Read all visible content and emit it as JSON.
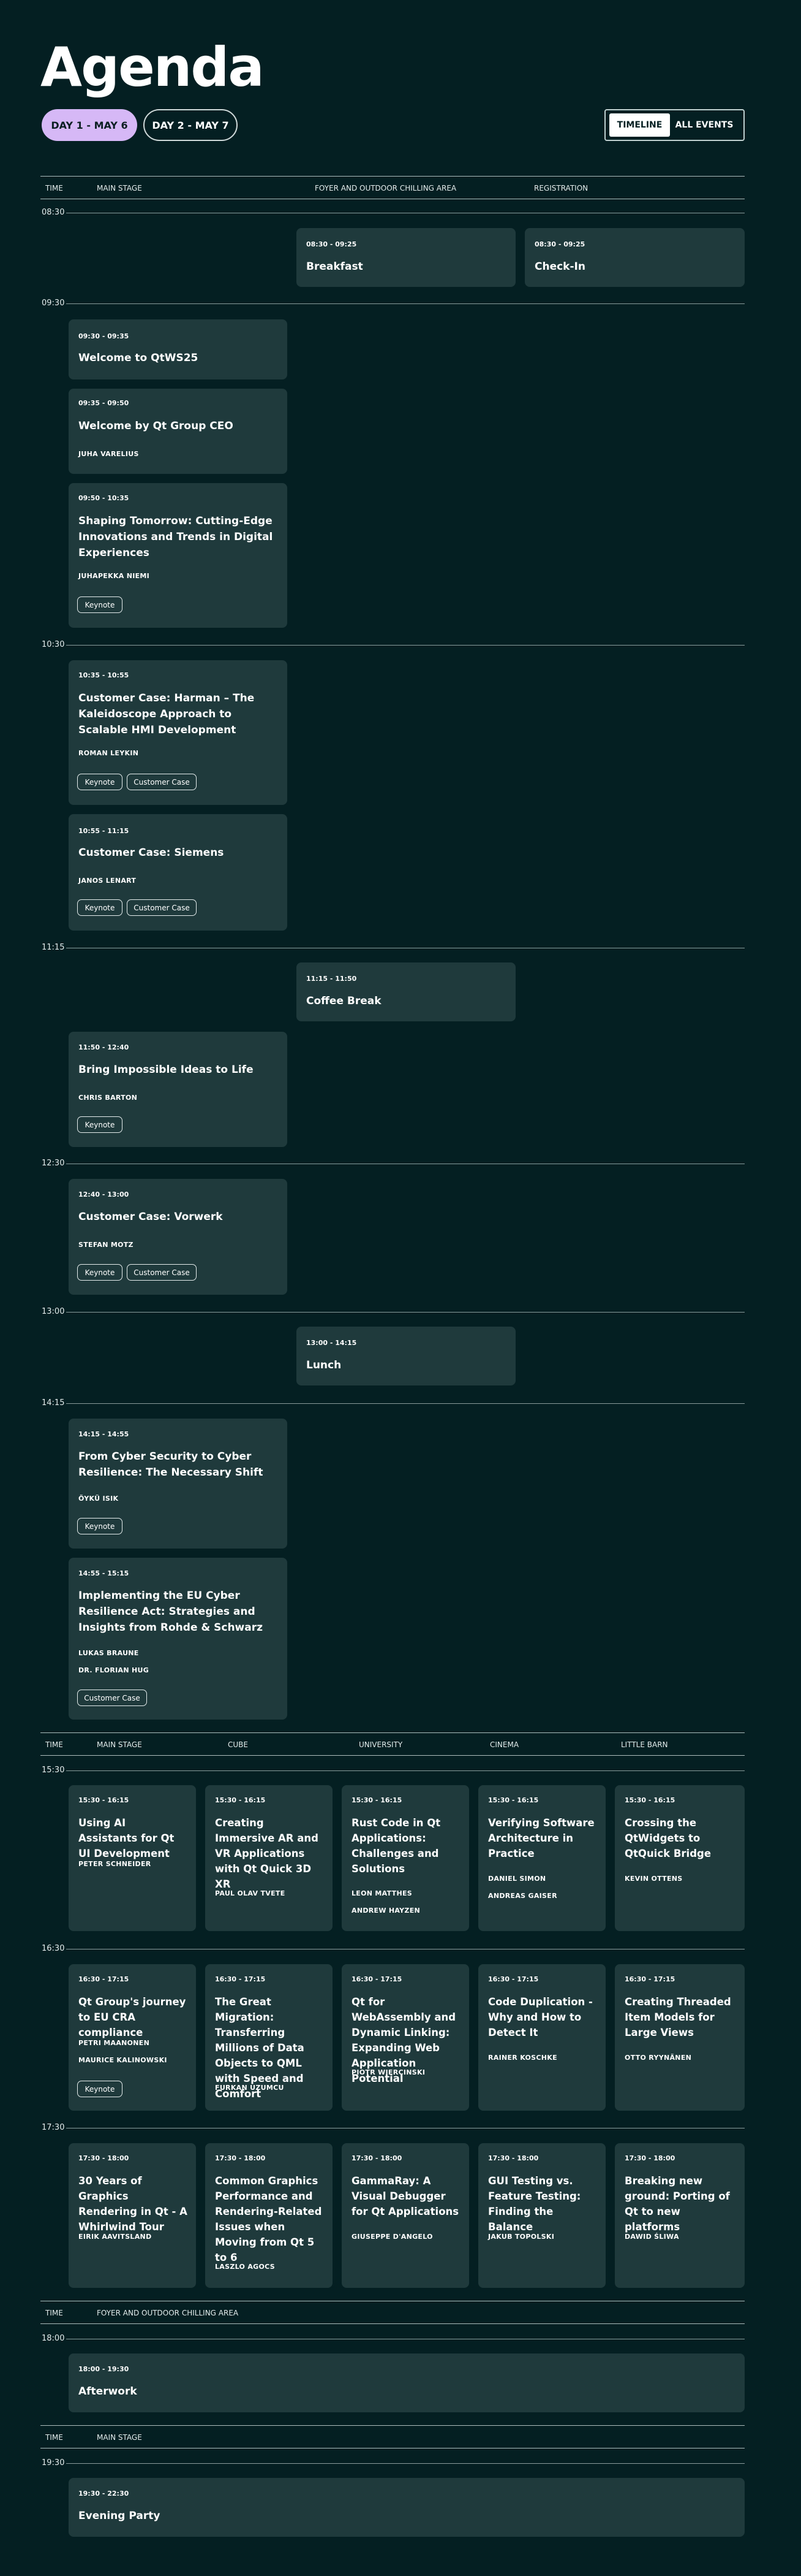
{
  "page": {
    "title": "Agenda"
  },
  "days": {
    "day1": "DAY 1 - MAY 6",
    "day2": "DAY 2 - MAY 7"
  },
  "view": {
    "timeline": "TIMELINE",
    "all_events": "ALL EVENTS"
  },
  "headers": {
    "time": "TIME",
    "main_stage": "MAIN STAGE",
    "foyer": "FOYER AND OUTDOOR CHILLING AREA",
    "registration": "REGISTRATION",
    "cube": "CUBE",
    "university": "UNIVERSITY",
    "cinema": "CINEMA",
    "little_barn": "LITTLE BARN"
  },
  "times": [
    "08:30",
    "09:30",
    "10:30",
    "11:15",
    "12:30",
    "13:00",
    "14:15",
    "15:30",
    "16:30",
    "17:30",
    "18:00",
    "19:30"
  ],
  "tags": {
    "keynote": "Keynote",
    "customer_case": "Customer Case"
  },
  "sessions": {
    "breakfast": {
      "time": "08:30 - 09:25",
      "title": "Breakfast"
    },
    "checkin": {
      "time": "08:30 - 09:25",
      "title": "Check-In"
    },
    "welcome": {
      "time": "09:30 - 09:35",
      "title": "Welcome to QtWS25"
    },
    "ceo": {
      "time": "09:35 - 09:50",
      "title": "Welcome by Qt Group CEO",
      "speaker": "JUHA VARELIUS"
    },
    "shaping": {
      "time": "09:50 - 10:35",
      "title": "Shaping Tomorrow: Cutting-Edge Innovations and Trends in Digital Experiences",
      "speaker": "JUHAPEKKA NIEMI"
    },
    "harman": {
      "time": "10:35 - 10:55",
      "title": "Customer Case: Harman – The Kaleidoscope Approach to Scalable HMI Development",
      "speaker": "ROMAN LEYKIN"
    },
    "siemens": {
      "time": "10:55 - 11:15",
      "title": "Customer Case: Siemens",
      "speaker": "JANOS LENART"
    },
    "coffee": {
      "time": "11:15 - 11:50",
      "title": "Coffee Break"
    },
    "bring": {
      "time": "11:50 - 12:40",
      "title": "Bring Impossible Ideas to Life",
      "speaker": "CHRIS BARTON"
    },
    "vorwerk": {
      "time": "12:40 - 13:00",
      "title": "Customer Case: Vorwerk",
      "speaker": "STEFAN MOTZ"
    },
    "lunch": {
      "time": "13:00 - 14:15",
      "title": "Lunch"
    },
    "cyber": {
      "time": "14:15 - 14:55",
      "title": "From Cyber Security to Cyber Resilience: The Necessary Shift",
      "speaker": "ÖYKÜ ISIK"
    },
    "eucra": {
      "time": "14:55 - 15:15",
      "title": "Implementing the EU Cyber Resilience Act: Strategies and Insights from Rohde & Schwarz",
      "speaker1": "LUKAS BRAUNE",
      "speaker2": "DR. FLORIAN HUG"
    },
    "ai": {
      "time": "15:30 - 16:15",
      "title": "Using AI Assistants for Qt UI Development",
      "speaker": "PETER SCHNEIDER"
    },
    "ar": {
      "time": "15:30 - 16:15",
      "title": "Creating Immersive AR and VR Applications with Qt Quick 3D XR",
      "speaker": "PAUL OLAV TVETE"
    },
    "rust": {
      "time": "15:30 - 16:15",
      "title": "Rust Code in Qt Applications: Challenges and Solutions",
      "speaker1": "LEON MATTHES",
      "speaker2": "ANDREW HAYZEN"
    },
    "verify": {
      "time": "15:30 - 16:15",
      "title": "Verifying Software Architecture in Practice",
      "speaker1": "DANIEL SIMON",
      "speaker2": "ANDREAS GAISER"
    },
    "crossing": {
      "time": "15:30 - 16:15",
      "title": "Crossing the QtWidgets to QtQuick Bridge",
      "speaker": "KEVIN OTTENS"
    },
    "cra": {
      "time": "16:30 - 17:15",
      "title": "Qt Group's journey to EU CRA compliance",
      "speaker1": "PETRI MAANONEN",
      "speaker2": "MAURICE KALINOWSKI"
    },
    "migration": {
      "time": "16:30 - 17:15",
      "title": "The Great Migration: Transferring Millions of Data Objects to QML with Speed and Comfort",
      "speaker": "FURKAN UZUMCU"
    },
    "wasm": {
      "time": "16:30 - 17:15",
      "title": "Qt for WebAssembly and Dynamic Linking: Expanding Web Application Potential",
      "speaker": "PIOTR WIERCINSKI"
    },
    "dup": {
      "time": "16:30 - 17:15",
      "title": "Code Duplication - Why and How to Detect It",
      "speaker": "RAINER KOSCHKE"
    },
    "threaded": {
      "time": "16:30 - 17:15",
      "title": "Creating Threaded Item Models for Large Views",
      "speaker": "OTTO RYYNÄNEN"
    },
    "graphics": {
      "time": "17:30 - 18:00",
      "title": "30 Years of Graphics Rendering in Qt - A Whirlwind Tour",
      "speaker": "EIRIK AAVITSLAND"
    },
    "perf": {
      "time": "17:30 - 18:00",
      "title": "Common Graphics Performance and Rendering-Related Issues when Moving from Qt 5 to 6",
      "speaker": "LASZLO AGOCS"
    },
    "gamma": {
      "time": "17:30 - 18:00",
      "title": "GammaRay: A Visual Debugger for Qt Applications",
      "speaker": "GIUSEPPE D'ANGELO"
    },
    "gui": {
      "time": "17:30 - 18:00",
      "title": "GUI Testing vs. Feature Testing: Finding the Balance",
      "speaker": "JAKUB TOPOLSKI"
    },
    "breaking": {
      "time": "17:30 - 18:00",
      "title": "Breaking new ground: Porting of Qt to new platforms",
      "speaker": "DAWID ŚLIWA"
    },
    "afterwork": {
      "time": "18:00 - 19:30",
      "title": "Afterwork"
    },
    "party": {
      "time": "19:30 - 22:30",
      "title": "Evening Party"
    }
  }
}
